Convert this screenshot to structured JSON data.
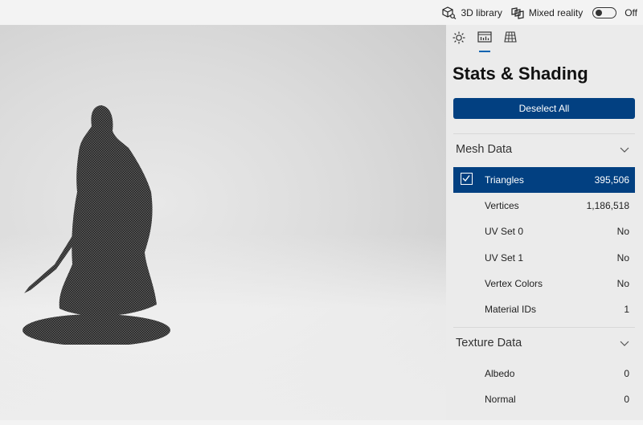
{
  "topbar": {
    "library_label": "3D library",
    "library_icon": "cube-search-icon",
    "mixed_reality_label": "Mixed reality",
    "mixed_reality_icon": "mixed-reality-icon",
    "toggle_state_label": "Off",
    "toggle_on": false
  },
  "panel": {
    "tabs": [
      {
        "icon": "sun-icon",
        "name": "lighting"
      },
      {
        "icon": "stats-icon",
        "name": "stats",
        "active": true
      },
      {
        "icon": "grid-icon",
        "name": "grid"
      }
    ],
    "title": "Stats & Shading",
    "deselect_label": "Deselect All",
    "accent_color": "#024081",
    "sections": [
      {
        "title": "Mesh Data",
        "rows": [
          {
            "label": "Triangles",
            "value": "395,506",
            "selected": true,
            "checked": true
          },
          {
            "label": "Vertices",
            "value": "1,186,518"
          },
          {
            "label": "UV Set 0",
            "value": "No"
          },
          {
            "label": "UV Set 1",
            "value": "No"
          },
          {
            "label": "Vertex Colors",
            "value": "No"
          },
          {
            "label": "Material IDs",
            "value": "1"
          }
        ]
      },
      {
        "title": "Texture Data",
        "rows": [
          {
            "label": "Albedo",
            "value": "0"
          },
          {
            "label": "Normal",
            "value": "0"
          }
        ]
      }
    ]
  },
  "viewport": {
    "model_description": "wireframe warrior statue with sword on round base"
  }
}
